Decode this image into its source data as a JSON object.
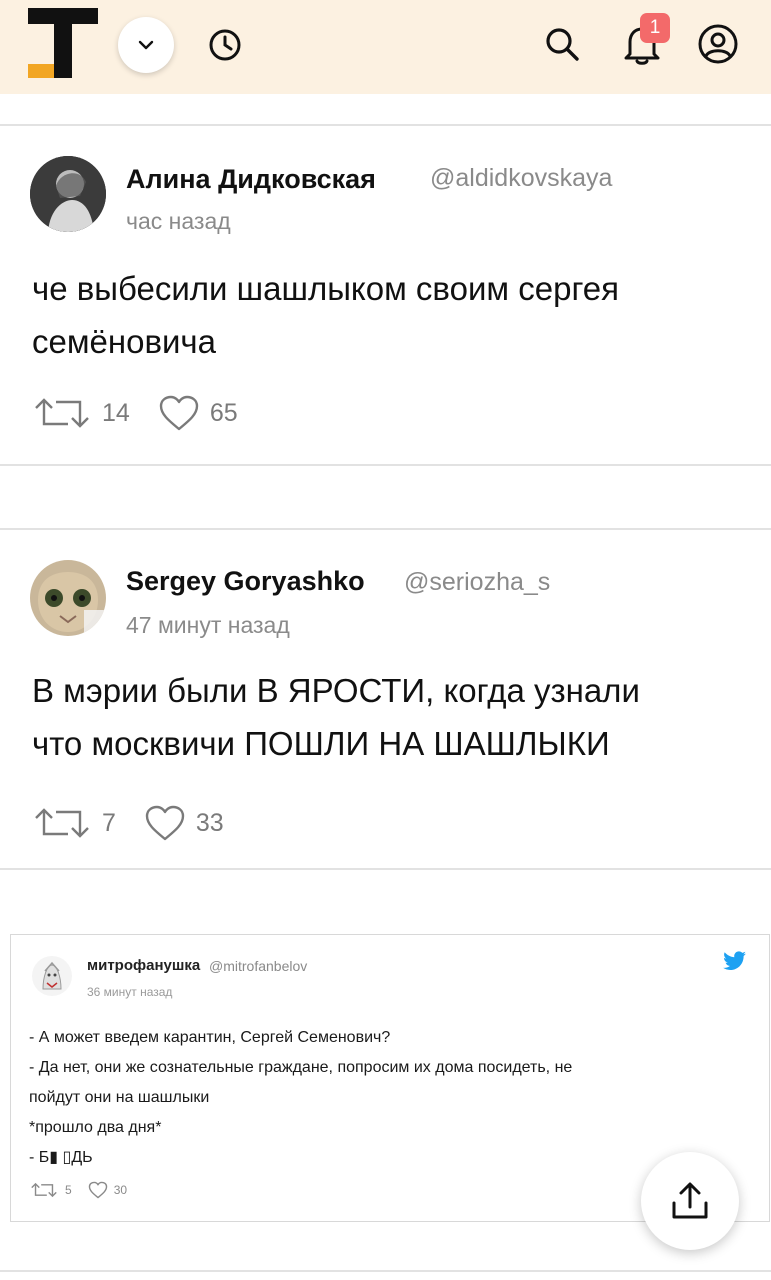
{
  "header": {
    "notifications_badge": "1",
    "bg_color": "#fcf1e1",
    "badge_color": "#f36a6a",
    "icons": [
      "tj-logo-icon",
      "chevron-down-icon",
      "clock-icon",
      "search-icon",
      "bell-icon",
      "profile-icon"
    ]
  },
  "feed": {
    "tweets": [
      {
        "author": "Алина Дидковская",
        "handle": "@aldidkovskaya",
        "time": "час назад",
        "text_lines": [
          "че выбесили шашлыком своим сергея",
          "семёновича"
        ],
        "retweets": "14",
        "likes": "65"
      },
      {
        "author": "Sergey Goryashko",
        "handle": "@seriozha_s",
        "time": "47 минут назад",
        "text_lines": [
          "В мэрии были В ЯРОСТИ, когда узнали",
          "что москвичи ПОШЛИ НА ШАШЛЫКИ"
        ],
        "retweets": "7",
        "likes": "33"
      }
    ],
    "embedded": {
      "author": "митрофанушка",
      "handle": "@mitrofanbelov",
      "time": "36 минут назад",
      "lines": [
        "- А может введем карантин, Сергей Семенович?",
        "- Да нет, они же сознательные граждане, попросим их дома посидеть, не",
        "пойдут они на шашлыки",
        "*прошло два дня*",
        "- Б▮ ▯ДЬ"
      ],
      "retweets": "5",
      "likes": "30",
      "accent": "#1da1f2"
    }
  }
}
